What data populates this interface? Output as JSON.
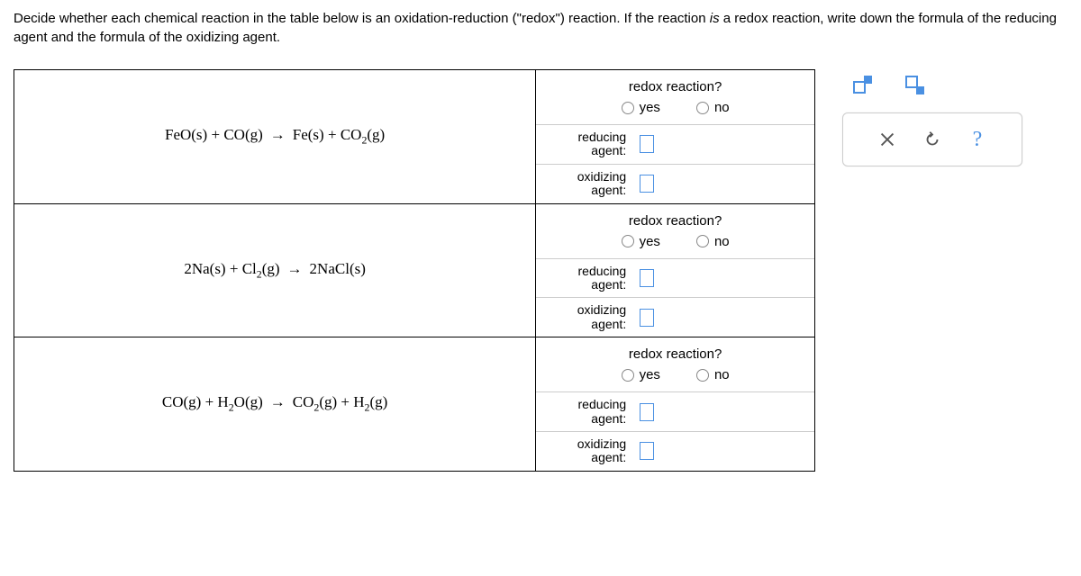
{
  "instructions": {
    "part1": "Decide whether each chemical reaction in the table below is an oxidation-reduction (\"redox\") reaction. If the reaction ",
    "em": "is",
    "part2": " a redox reaction, write down the formula of the reducing agent and the formula of the oxidizing agent."
  },
  "labels": {
    "redox_q": "redox reaction?",
    "yes": "yes",
    "no": "no",
    "reducing": "reducing agent:",
    "oxidizing": "oxidizing agent:",
    "help": "?"
  },
  "reactions": {
    "r1": {
      "lhs_1": "FeO",
      "state_1": "(s)",
      "plus_a": " + ",
      "lhs_2": "CO",
      "state_2": "(g)",
      "arrow": "→",
      "rhs_1": "Fe",
      "state_3": "(s)",
      "plus_b": " + ",
      "rhs_2a": "CO",
      "rhs_2sub": "2",
      "state_4": "(g)"
    },
    "r2": {
      "lhs_1": "2Na",
      "state_1": "(s)",
      "plus_a": " + ",
      "lhs_2a": "Cl",
      "lhs_2sub": "2",
      "state_2": "(g)",
      "arrow": "→",
      "rhs_1": "2NaCl",
      "state_3": "(s)"
    },
    "r3": {
      "lhs_1": "CO",
      "state_1": "(g)",
      "plus_a": " + ",
      "lhs_2a": "H",
      "lhs_2sub": "2",
      "lhs_2b": "O",
      "state_2": "(g)",
      "arrow": "→",
      "rhs_1a": "CO",
      "rhs_1sub": "2",
      "state_3": "(g)",
      "plus_b": " + ",
      "rhs_2a": "H",
      "rhs_2sub": "2",
      "state_4": "(g)"
    }
  }
}
